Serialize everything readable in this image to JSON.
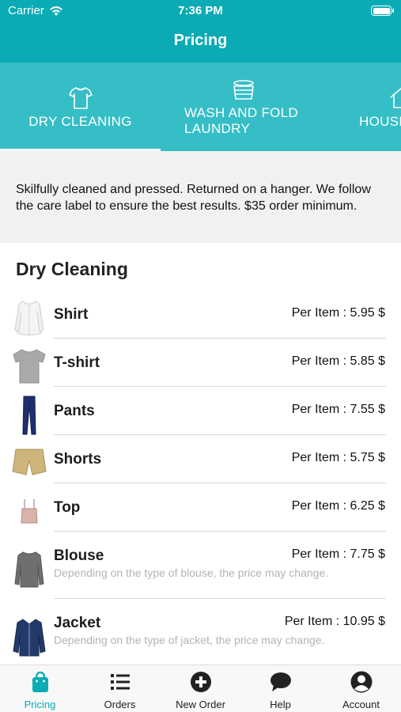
{
  "status_bar": {
    "carrier": "Carrier",
    "time": "7:36 PM"
  },
  "nav": {
    "title": "Pricing"
  },
  "categories": [
    {
      "label": "DRY CLEANING",
      "icon": "shirt-icon",
      "selected": true
    },
    {
      "label": "WASH AND FOLD LAUNDRY",
      "icon": "laundry-basket-icon",
      "selected": false
    },
    {
      "label": "HOUSE",
      "icon": "house-icon",
      "selected": false
    }
  ],
  "description": "Skilfully cleaned and pressed. Returned on a hanger. We follow the care label to ensure the best results. $35 order minimum.",
  "section": {
    "title": "Dry Cleaning"
  },
  "items": [
    {
      "name": "Shirt",
      "price": "Per Item : 5.95 $",
      "note": "",
      "thumb": "white-shirt"
    },
    {
      "name": "T-shirt",
      "price": "Per Item : 5.85 $",
      "note": "",
      "thumb": "grey-tshirt"
    },
    {
      "name": "Pants",
      "price": "Per Item : 7.55 $",
      "note": "",
      "thumb": "navy-pants"
    },
    {
      "name": "Shorts",
      "price": "Per Item : 5.75 $",
      "note": "",
      "thumb": "khaki-shorts"
    },
    {
      "name": "Top",
      "price": "Per Item : 6.25 $",
      "note": "",
      "thumb": "pink-top"
    },
    {
      "name": "Blouse",
      "price": "Per Item : 7.75 $",
      "note": "Depending on the type of blouse, the price may change.",
      "thumb": "grey-blouse"
    },
    {
      "name": "Jacket",
      "price": "Per Item : 10.95 $",
      "note": "Depending on the type of jacket, the price may change.",
      "thumb": "navy-jacket"
    }
  ],
  "tabbar": [
    {
      "label": "Pricing",
      "icon": "shopping-bag-icon",
      "active": true
    },
    {
      "label": "Orders",
      "icon": "list-icon",
      "active": false
    },
    {
      "label": "New Order",
      "icon": "plus-circle-icon",
      "active": false
    },
    {
      "label": "Help",
      "icon": "chat-bubble-icon",
      "active": false
    },
    {
      "label": "Account",
      "icon": "user-circle-icon",
      "active": false
    }
  ],
  "colors": {
    "primary": "#0aabb4",
    "tabs_bg": "#36bec6",
    "description_bg": "#f1f1f4",
    "note_text": "#b3b3b3"
  }
}
